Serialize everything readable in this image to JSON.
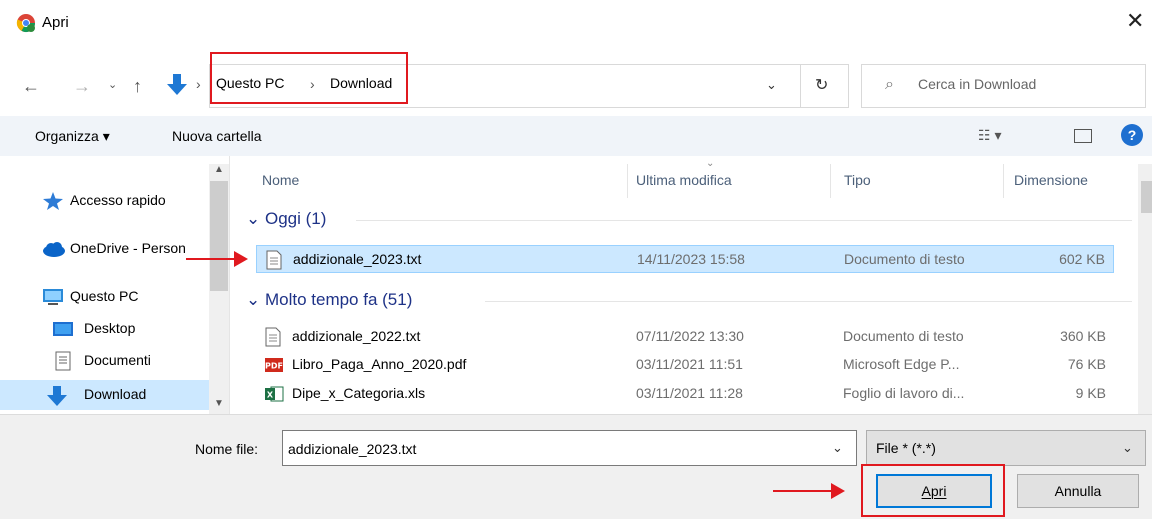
{
  "window": {
    "title": "Apri"
  },
  "address": {
    "crumbs": [
      "Questo PC",
      "Download"
    ],
    "search_placeholder": "Cerca in Download"
  },
  "toolbar": {
    "organize": "Organizza ▾",
    "new_folder": "Nuova cartella"
  },
  "sidebar": {
    "items": [
      {
        "label": "Accesso rapido",
        "icon": "star-pin-icon"
      },
      {
        "label": "OneDrive - Person",
        "icon": "cloud-icon"
      },
      {
        "label": "Questo PC",
        "icon": "computer-icon"
      },
      {
        "label": "Desktop",
        "icon": "desktop-icon"
      },
      {
        "label": "Documenti",
        "icon": "documents-icon"
      },
      {
        "label": "Download",
        "icon": "download-icon",
        "selected": true
      }
    ]
  },
  "columns": {
    "name": "Nome",
    "modified": "Ultima modifica",
    "type": "Tipo",
    "size": "Dimensione"
  },
  "groups": {
    "today": "Oggi (1)",
    "long_ago": "Molto tempo fa (51)"
  },
  "files": [
    {
      "name": "addizionale_2023.txt",
      "modified": "14/11/2023 15:58",
      "type": "Documento di testo",
      "size": "602 KB",
      "icon": "text-file-icon",
      "selected": true
    },
    {
      "name": "addizionale_2022.txt",
      "modified": "07/11/2022 13:30",
      "type": "Documento di testo",
      "size": "360 KB",
      "icon": "text-file-icon"
    },
    {
      "name": "Libro_Paga_Anno_2020.pdf",
      "modified": "03/11/2021 11:51",
      "type": "Microsoft Edge P...",
      "size": "76 KB",
      "icon": "pdf-file-icon"
    },
    {
      "name": "Dipe_x_Categoria.xls",
      "modified": "03/11/2021 11:28",
      "type": "Foglio di lavoro di...",
      "size": "9 KB",
      "icon": "excel-file-icon"
    }
  ],
  "bottom": {
    "filename_label": "Nome file:",
    "filename_value": "addizionale_2023.txt",
    "filetype_value": "File * (*.*)",
    "open_button": "Apri",
    "cancel_button": "Annulla"
  },
  "colors": {
    "accent": "#0078d7",
    "highlight": "#e0191f",
    "selection": "#cce8ff",
    "group_text": "#1e3287"
  }
}
